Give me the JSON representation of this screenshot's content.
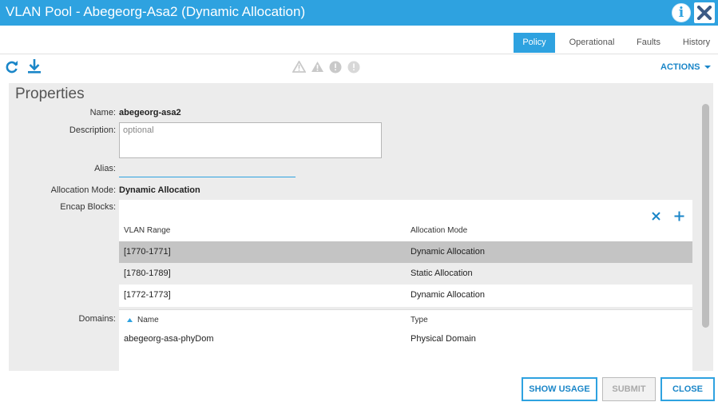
{
  "window": {
    "title": "VLAN Pool - Abegeorg-Asa2 (Dynamic Allocation)",
    "info_glyph": "i"
  },
  "tabs": [
    {
      "label": "Policy",
      "active": true
    },
    {
      "label": "Operational",
      "active": false
    },
    {
      "label": "Faults",
      "active": false
    },
    {
      "label": "History",
      "active": false
    }
  ],
  "toolbar": {
    "actions_label": "ACTIONS"
  },
  "properties": {
    "heading": "Properties",
    "name_label": "Name:",
    "name_value": "abegeorg-asa2",
    "description_label": "Description:",
    "description_placeholder": "optional",
    "description_value": "",
    "alias_label": "Alias:",
    "alias_value": "",
    "allocation_mode_label": "Allocation Mode:",
    "allocation_mode_value": "Dynamic Allocation",
    "encap_blocks_label": "Encap Blocks:",
    "domains_label": "Domains:"
  },
  "encap_table": {
    "columns": [
      "VLAN Range",
      "Allocation Mode"
    ],
    "rows": [
      {
        "range": "[1770-1771]",
        "mode": "Dynamic Allocation",
        "selected": true
      },
      {
        "range": "[1780-1789]",
        "mode": "Static Allocation",
        "selected": false
      },
      {
        "range": "[1772-1773]",
        "mode": "Dynamic Allocation",
        "selected": false
      }
    ]
  },
  "domains_table": {
    "columns": [
      "Name",
      "Type"
    ],
    "sort_column": "Name",
    "rows": [
      {
        "name": "abegeorg-asa-phyDom",
        "type": "Physical Domain"
      }
    ]
  },
  "footer": {
    "show_usage": "SHOW USAGE",
    "submit": "SUBMIT",
    "close": "CLOSE"
  },
  "colors": {
    "accent": "#2ea2e0",
    "link": "#1a86c8",
    "selected_row": "#c4c4c4",
    "panel_bg": "#ececec"
  },
  "icons": [
    "info-icon",
    "close-icon",
    "refresh-icon",
    "download-icon",
    "critical-fault-icon",
    "major-fault-icon",
    "minor-fault-icon",
    "warning-fault-icon",
    "chevron-down-icon",
    "delete-icon",
    "add-icon",
    "sort-ascending-icon"
  ]
}
